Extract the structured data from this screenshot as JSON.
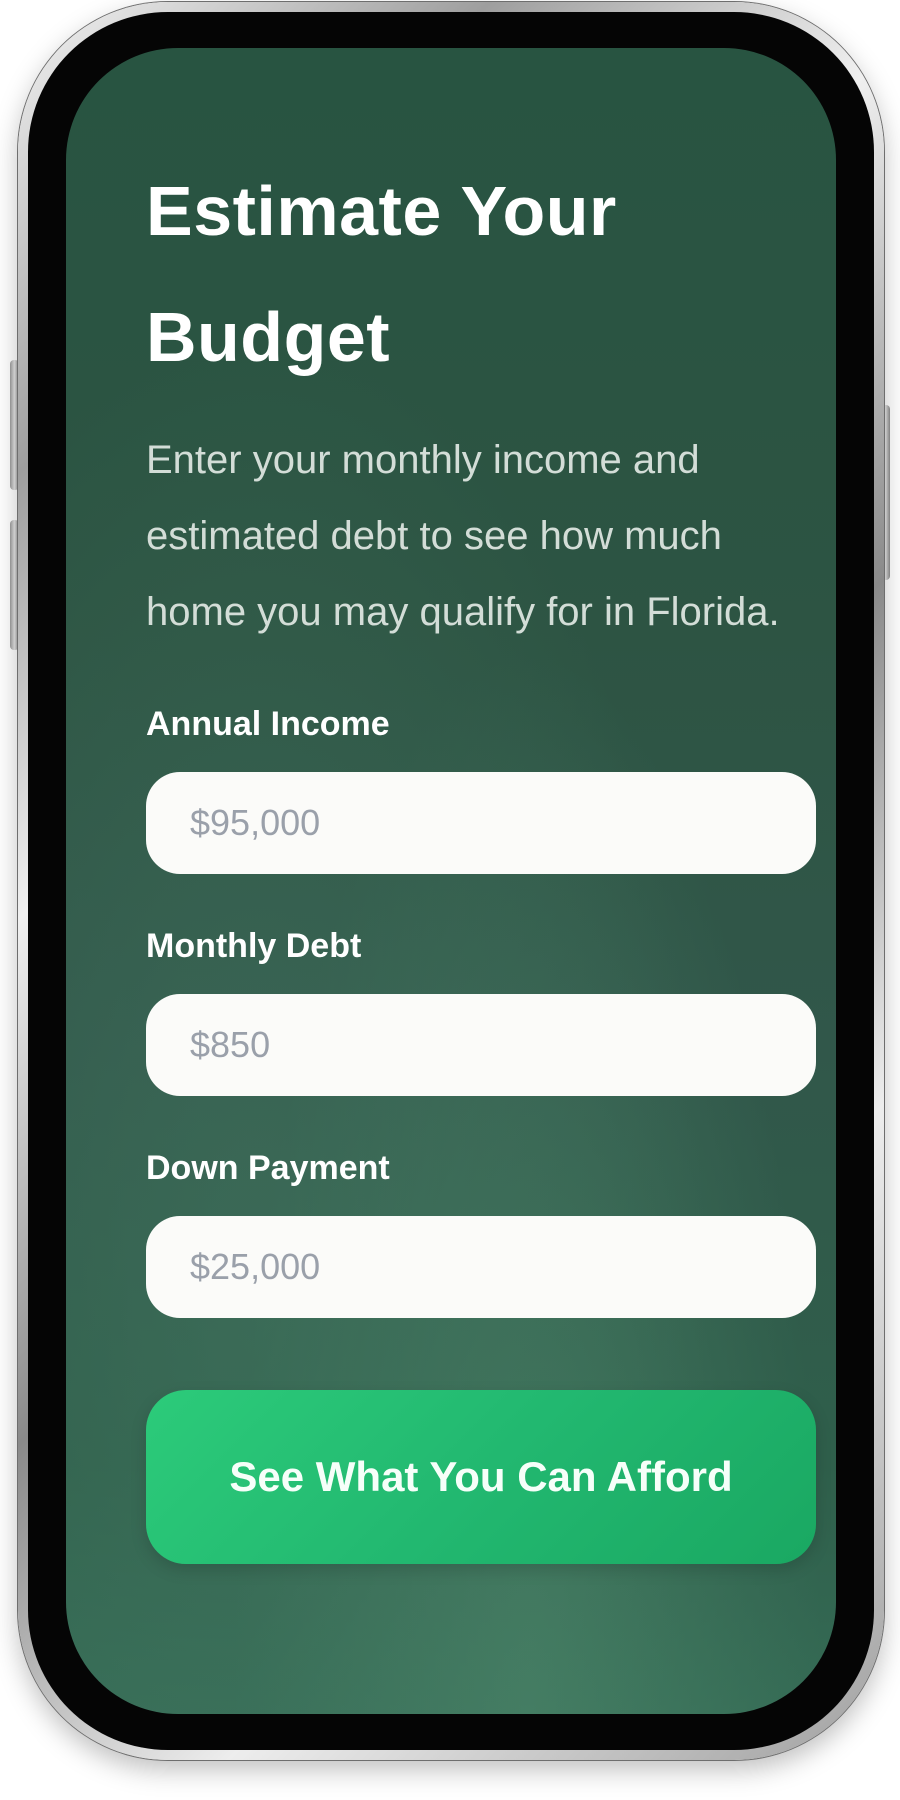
{
  "header": {
    "title": "Estimate Your Budget",
    "subtitle": "Enter your monthly income and estimated debt to see how much home you may qualify for in Florida."
  },
  "form": {
    "fields": [
      {
        "label": "Annual Income",
        "placeholder": "$95,000"
      },
      {
        "label": "Monthly Debt",
        "placeholder": "$850"
      },
      {
        "label": "Down Payment",
        "placeholder": "$25,000"
      }
    ],
    "submit_label": "See What You Can Afford"
  },
  "colors": {
    "background": "#2d5443",
    "accent": "#22b870",
    "input_background": "#fbfbf9"
  }
}
